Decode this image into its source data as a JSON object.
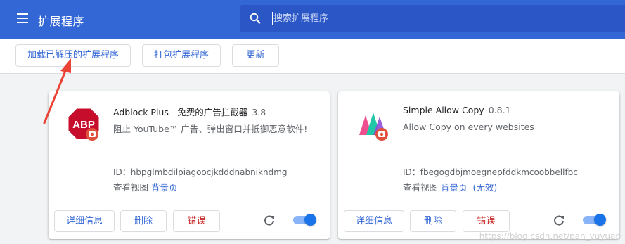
{
  "header": {
    "title": "扩展程序",
    "menu_icon": "hamburger-menu-icon",
    "search": {
      "placeholder": "搜索扩展程序",
      "value": "",
      "icon": "search-icon"
    }
  },
  "toolbar": {
    "load_unpacked_label": "加载已解压的扩展程序",
    "pack_label": "打包扩展程序",
    "update_label": "更新"
  },
  "extensions": [
    {
      "name": "Adblock Plus - 免费的广告拦截器",
      "version": "3.8",
      "description": "阻止 YouTube™ 广告、弹出窗口并抵御恶意软件!",
      "id_text": "ID：hbpglmbdilpiagoocjkdddnabnikndmg",
      "views_label": "查看视图",
      "views_links": [
        "背景页"
      ],
      "details_label": "详细信息",
      "remove_label": "删除",
      "errors_label": "错误",
      "enabled": true,
      "icon": "adblock-plus-icon"
    },
    {
      "name": "Simple Allow Copy",
      "version": "0.8.1",
      "description": "Allow Copy on every websites",
      "id_text": "ID：fbegogdbjmoegnepfddkmcoobbellfbc",
      "views_label": "查看视图",
      "views_links": [
        "背景页",
        "(无效)"
      ],
      "details_label": "详细信息",
      "remove_label": "删除",
      "errors_label": "错误",
      "enabled": true,
      "icon": "simple-allow-copy-icon"
    }
  ],
  "watermark": "https://blog.csdn.net/pan_yuyuan",
  "colors": {
    "header_bg": "#3367d6",
    "search_bg": "#2a56c6",
    "accent": "#3367d6",
    "error": "#c5221f",
    "toggle_on": "#1a73e8",
    "annotation_arrow": "#ea4335"
  }
}
